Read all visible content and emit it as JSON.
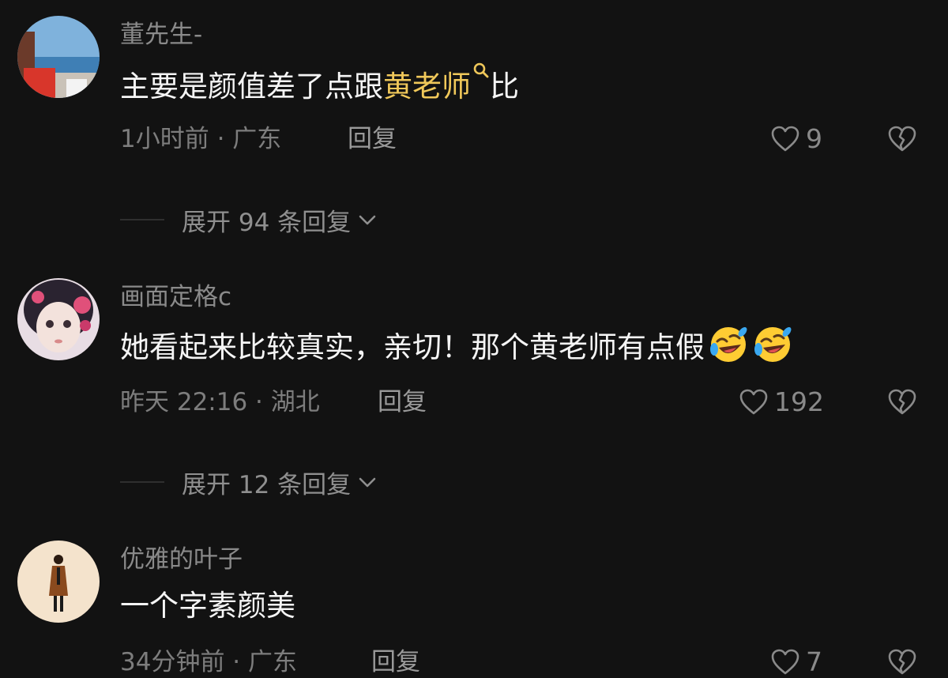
{
  "comments": [
    {
      "username": "董先生-",
      "text_before": "主要是颜值差了点跟",
      "highlight": "黄老师",
      "text_after": "比",
      "time_location": "1小时前 · 广东",
      "reply_label": "回复",
      "likes": "9",
      "expand_label": "展开 94 条回复"
    },
    {
      "username": "画面定格c",
      "text": "她看起来比较真实，亲切！那个黄老师有点假",
      "emoji": [
        "rolling-on-floor-laughing-emoji",
        "rolling-on-floor-laughing-emoji"
      ],
      "time_location": "昨天 22:16 · 湖北",
      "reply_label": "回复",
      "likes": "192",
      "expand_label": "展开 12 条回复"
    },
    {
      "username": "优雅的叶子",
      "text": "一个字素颜美",
      "time_location": "34分钟前 · 广东",
      "reply_label": "回复",
      "likes": "7"
    }
  ],
  "colors": {
    "background": "#121212",
    "highlight": "#f0c85a",
    "secondary_text": "#8a8a8a"
  }
}
